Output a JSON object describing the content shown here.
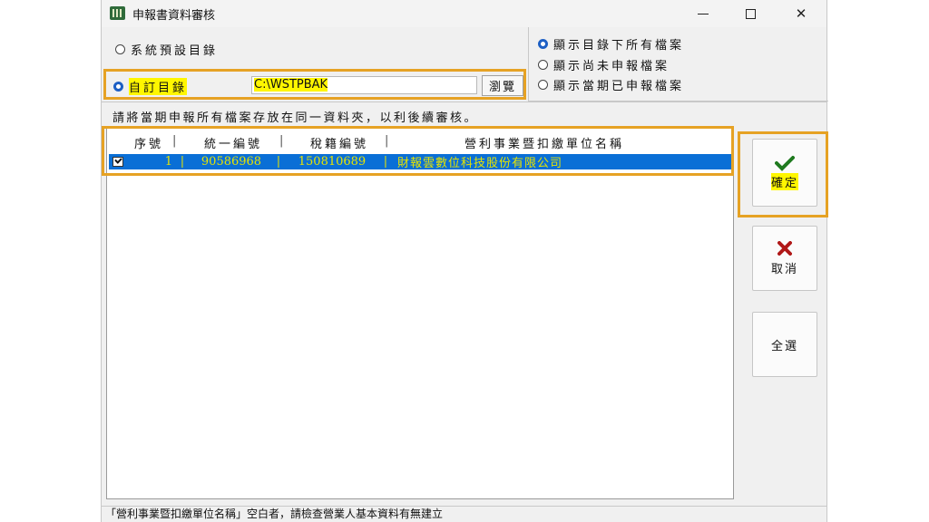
{
  "window": {
    "title": "申報書資料審核",
    "controls": {
      "minimize": "—",
      "maximize": "☐",
      "close": "✕"
    }
  },
  "directory_options": {
    "default_dir_label": "系統預設目錄",
    "custom_dir_label": "自訂目錄",
    "custom_dir_selected": true,
    "path_value": "C:\\WSTPBAK",
    "browse_label": "瀏覽"
  },
  "file_filter": {
    "options": [
      {
        "label": "顯示目錄下所有檔案",
        "selected": true
      },
      {
        "label": "顯示尚未申報檔案",
        "selected": false
      },
      {
        "label": "顯示當期已申報檔案",
        "selected": false
      }
    ]
  },
  "instruction_text": "請將當期申報所有檔案存放在同一資料夾，以利後續審核。",
  "table": {
    "headers": {
      "seq": "序號",
      "unified_no": "統一編號",
      "tax_no": "稅籍編號",
      "name": "營利事業暨扣繳單位名稱"
    },
    "rows": [
      {
        "checked": true,
        "seq": "1",
        "unified_no": "90586968",
        "tax_no": "150810689",
        "name": "財報雲數位科技股份有限公司"
      }
    ]
  },
  "actions": {
    "confirm_label": "確定",
    "cancel_label": "取消",
    "select_all_label": "全選"
  },
  "status_text": "「營利事業暨扣繳單位名稱」空白者，請檢查營業人基本資料有無建立",
  "colors": {
    "highlight_box": "#e6a224",
    "text_highlight": "#fff600",
    "selected_row_bg": "#0a6fd6",
    "selected_row_text": "#e8e400",
    "confirm_icon": "#1f7a1f",
    "cancel_icon": "#b01818"
  }
}
